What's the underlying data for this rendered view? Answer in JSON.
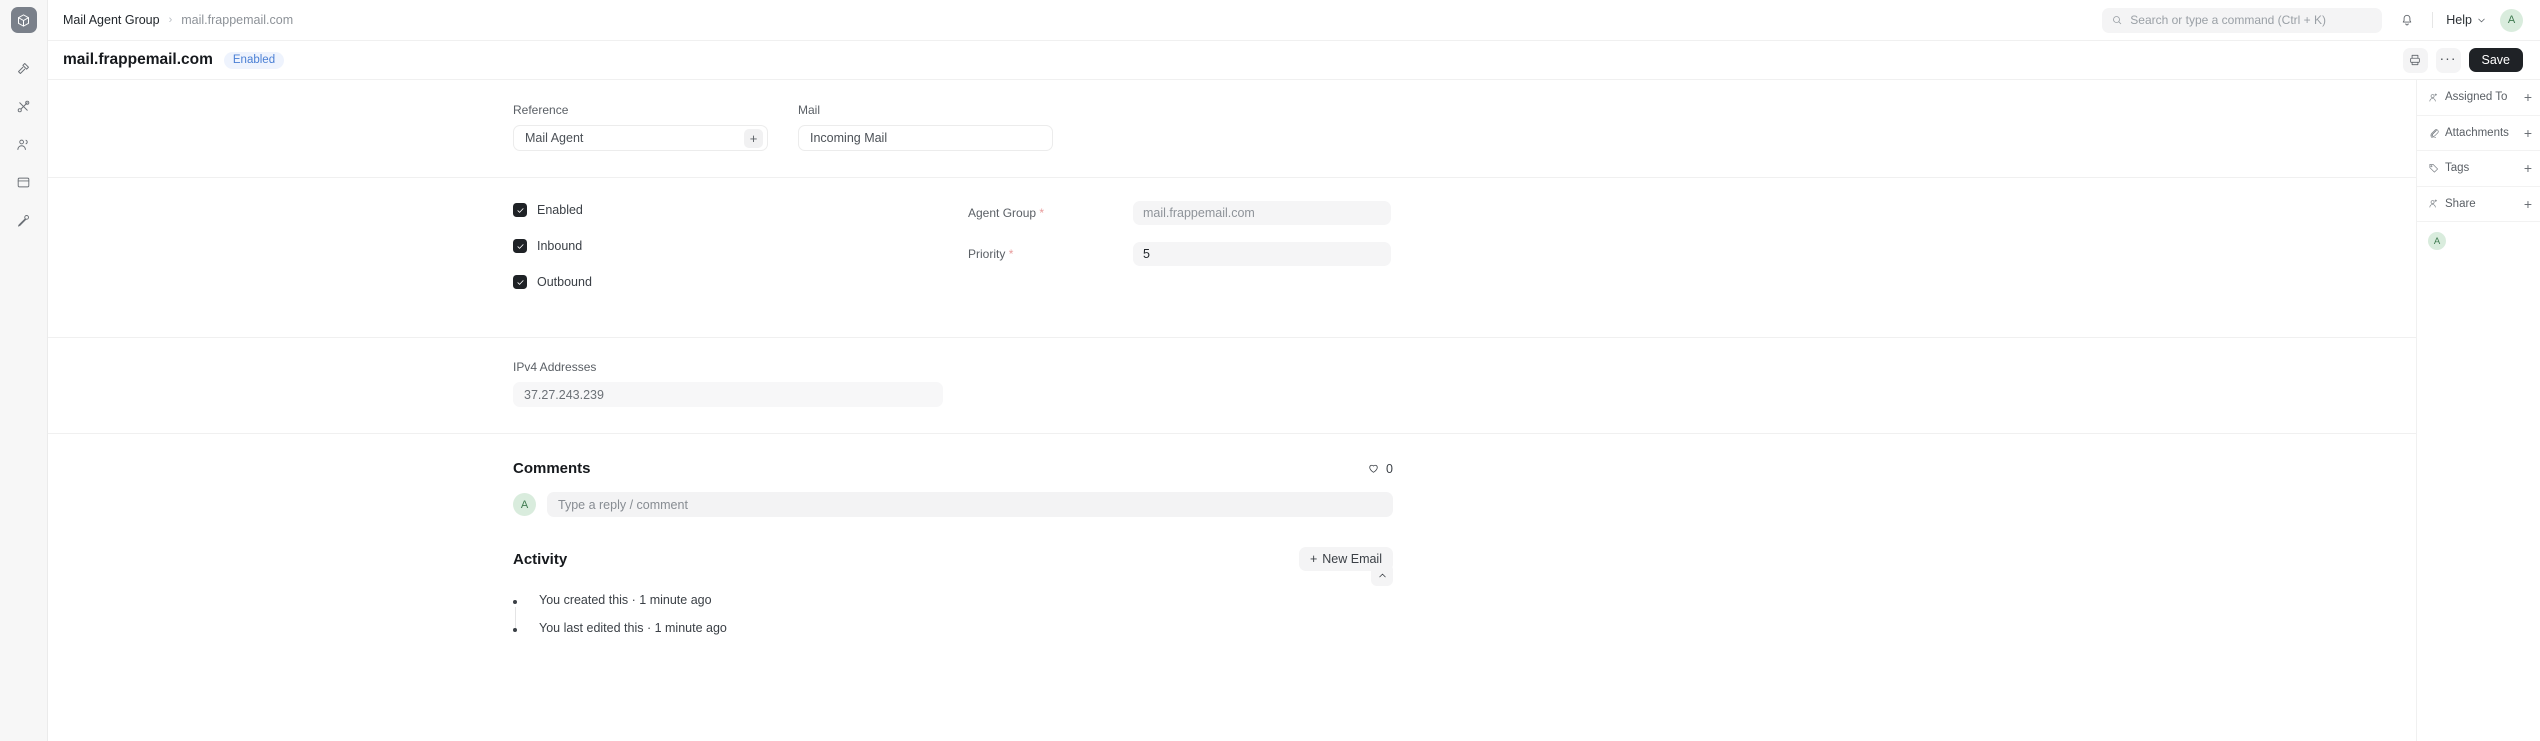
{
  "rail": {
    "logo_icon": "cube-logo-icon",
    "items": [
      {
        "icon": "hammer-icon",
        "name": "tools"
      },
      {
        "icon": "scissors-icon",
        "name": "build"
      },
      {
        "icon": "users-icon",
        "name": "users"
      },
      {
        "icon": "window-icon",
        "name": "workspace"
      },
      {
        "icon": "key-icon",
        "name": "permissions"
      }
    ]
  },
  "topbar": {
    "breadcrumb": {
      "parent": "Mail Agent Group",
      "separator": "›",
      "current": "mail.frappemail.com"
    },
    "search": {
      "placeholder": "Search or type a command (Ctrl + K)",
      "icon": "search-icon"
    },
    "notification_icon": "bell-icon",
    "help": {
      "label": "Help",
      "icon": "chevron-down-icon"
    },
    "avatar": {
      "initial": "A",
      "bg": "#d9ecdd",
      "fg": "#3f7a50"
    }
  },
  "titlebar": {
    "title": "mail.frappemail.com",
    "status_badge": {
      "label": "Enabled",
      "bg": "#eef3fd",
      "fg": "#4a7fd4"
    },
    "print_icon": "printer-icon",
    "more_label": "···",
    "save_label": "Save"
  },
  "form": {
    "reference": {
      "label": "Reference",
      "value": "Mail Agent",
      "add_icon": "plus-icon"
    },
    "mail": {
      "label": "Mail",
      "value": "Incoming Mail"
    },
    "checkboxes": [
      {
        "label": "Enabled",
        "checked": true
      },
      {
        "label": "Inbound",
        "checked": true
      },
      {
        "label": "Outbound",
        "checked": true
      }
    ],
    "fields": [
      {
        "label": "Agent Group",
        "required": true,
        "value": "mail.frappemail.com",
        "muted": true
      },
      {
        "label": "Priority",
        "required": true,
        "value": "5",
        "muted": false
      }
    ],
    "ipv4": {
      "label": "IPv4 Addresses",
      "value": "37.27.243.239"
    }
  },
  "comments": {
    "heading": "Comments",
    "like_icon": "heart-icon",
    "like_count": "0",
    "avatar_initial": "A",
    "reply_placeholder": "Type a reply / comment"
  },
  "activity": {
    "heading": "Activity",
    "new_email_label": "New Email",
    "new_email_icon": "plus-icon",
    "collapse_icon": "chevron-up-icon",
    "entries": [
      "You created this · 1 minute ago",
      "You last edited this · 1 minute ago"
    ]
  },
  "right_panel": {
    "rows": [
      {
        "label": "Assigned To",
        "icon": "user-plus-icon",
        "add": "+"
      },
      {
        "label": "Attachments",
        "icon": "paperclip-icon",
        "add": "+"
      },
      {
        "label": "Tags",
        "icon": "tag-icon",
        "add": "+"
      },
      {
        "label": "Share",
        "icon": "user-share-icon",
        "add": "+"
      }
    ],
    "member_avatar": {
      "initial": "A"
    }
  }
}
